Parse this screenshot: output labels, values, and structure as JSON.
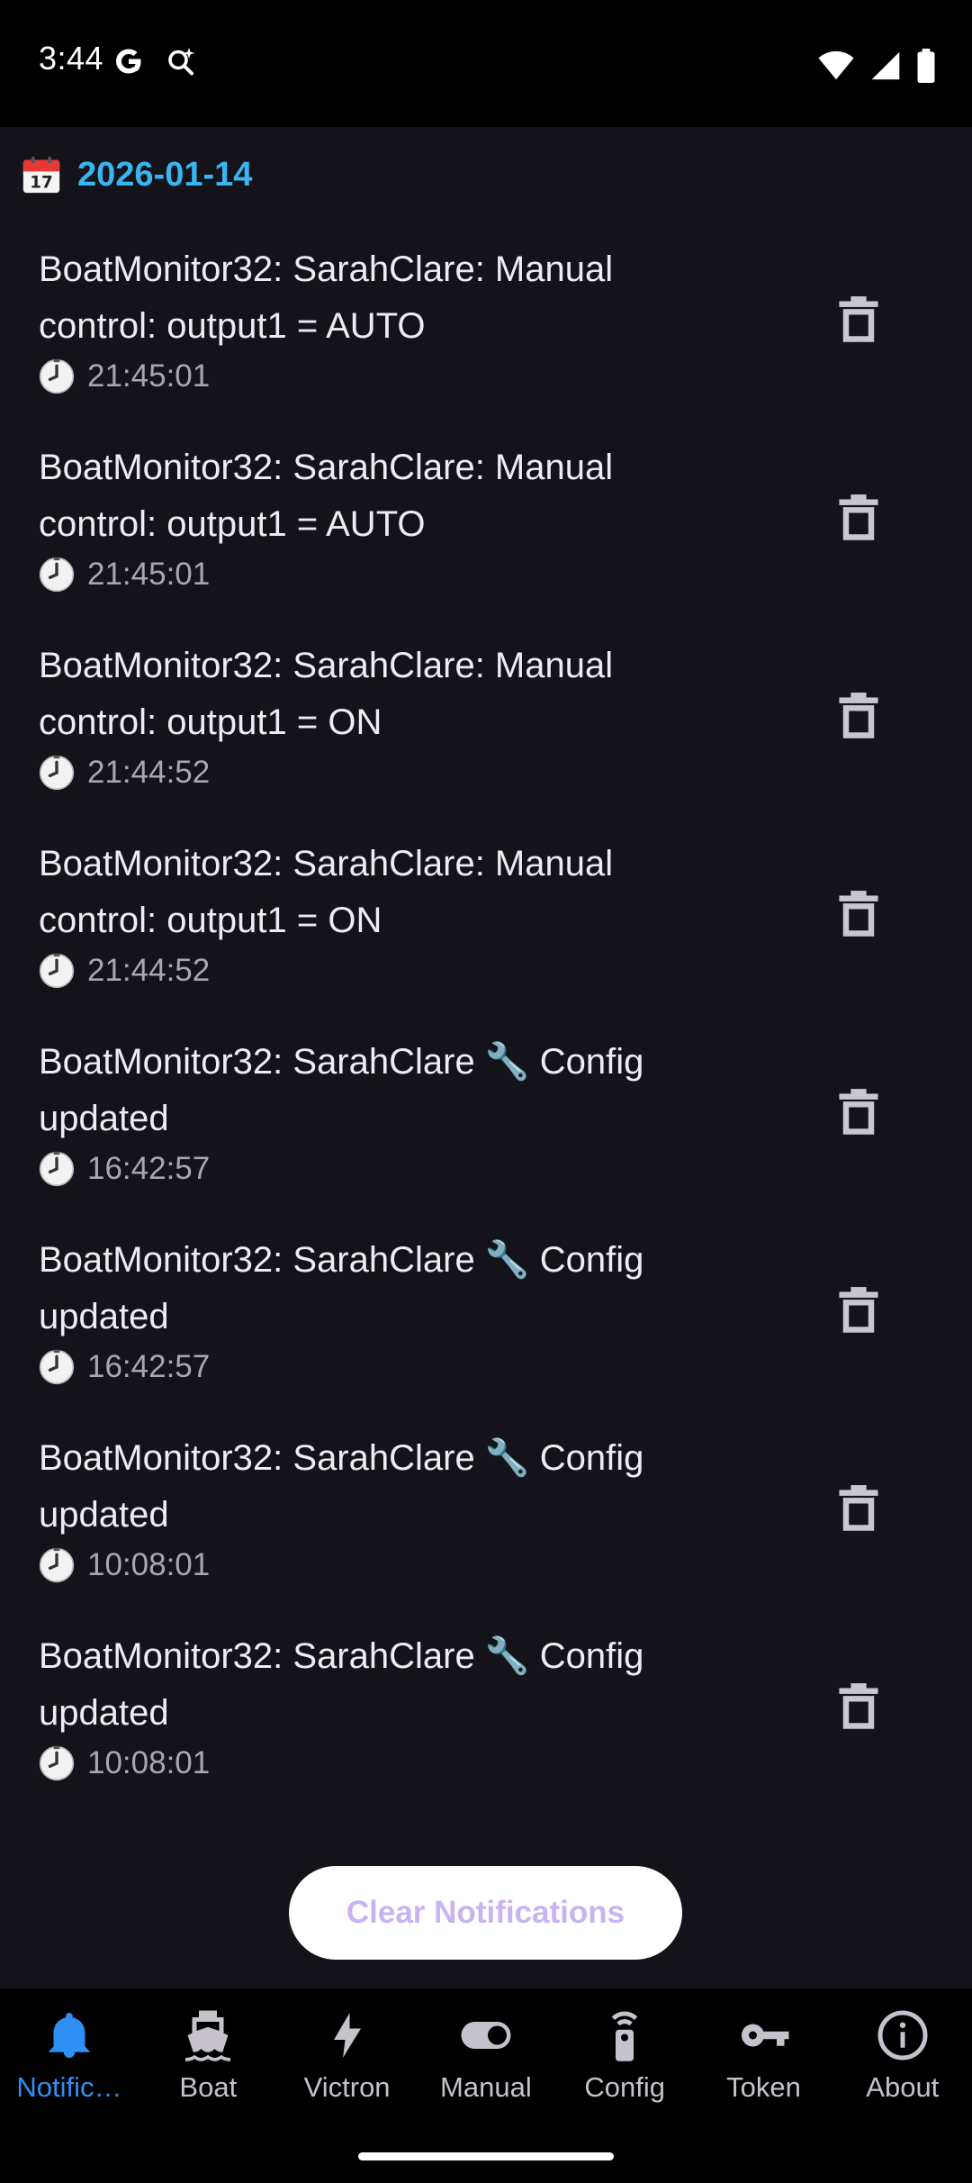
{
  "status": {
    "time": "3:44"
  },
  "date_header": "2026-01-14",
  "notifications": [
    {
      "line1": "BoatMonitor32: SarahClare: Manual",
      "line2": "control: output1 = AUTO",
      "time": "21:45:01"
    },
    {
      "line1": "BoatMonitor32: SarahClare: Manual",
      "line2": "control: output1 = AUTO",
      "time": "21:45:01"
    },
    {
      "line1": "BoatMonitor32: SarahClare: Manual",
      "line2": "control: output1 = ON",
      "time": "21:44:52"
    },
    {
      "line1": "BoatMonitor32: SarahClare: Manual",
      "line2": "control: output1 = ON",
      "time": "21:44:52"
    },
    {
      "line1": "BoatMonitor32: SarahClare 🔧 Config",
      "line2": "updated",
      "time": "16:42:57"
    },
    {
      "line1": "BoatMonitor32: SarahClare 🔧 Config",
      "line2": "updated",
      "time": "16:42:57"
    },
    {
      "line1": "BoatMonitor32: SarahClare 🔧 Config",
      "line2": "updated",
      "time": "10:08:01"
    },
    {
      "line1": "BoatMonitor32: SarahClare 🔧 Config",
      "line2": "updated",
      "time": "10:08:01"
    }
  ],
  "clear_button": "Clear Notifications",
  "nav": [
    {
      "label": "Notific…",
      "icon": "bell-icon",
      "active": true
    },
    {
      "label": "Boat",
      "icon": "boat-icon"
    },
    {
      "label": "Victron",
      "icon": "bolt-icon"
    },
    {
      "label": "Manual",
      "icon": "toggle-icon"
    },
    {
      "label": "Config",
      "icon": "remote-icon"
    },
    {
      "label": "Token",
      "icon": "key-icon"
    },
    {
      "label": "About",
      "icon": "info-icon"
    }
  ],
  "colors": {
    "accent": "#2f8ff5",
    "date": "#39b6f2",
    "background": "#14131a"
  }
}
